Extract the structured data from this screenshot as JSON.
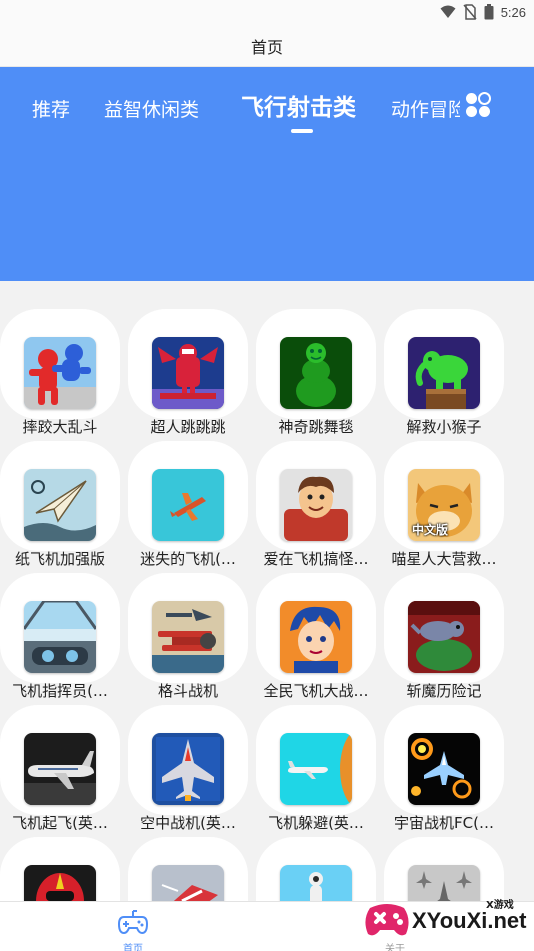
{
  "status_bar": {
    "time": "5:26",
    "icons": [
      "wifi-icon",
      "no-sim-icon",
      "battery-icon"
    ]
  },
  "app_bar": {
    "title": "首页"
  },
  "colors": {
    "accent": "#4f8ef7",
    "background": "#f2f2f2",
    "card": "#ffffff"
  },
  "tabs": [
    {
      "label": "推荐",
      "active": false
    },
    {
      "label": "益智休闲类",
      "active": false
    },
    {
      "label": "飞行射击类",
      "active": true
    },
    {
      "label": "动作冒险类",
      "active": false
    }
  ],
  "games": [
    {
      "name": "摔跤大乱斗",
      "icon": "wrestling-game-icon"
    },
    {
      "name": "超人跳跳跳",
      "icon": "superhero-game-icon"
    },
    {
      "name": "神奇跳舞毯",
      "icon": "dance-game-icon"
    },
    {
      "name": "解救小猴子",
      "icon": "elephant-game-icon"
    },
    {
      "name": "纸飞机加强版",
      "icon": "paper-plane-game-icon"
    },
    {
      "name": "迷失的飞机(…",
      "icon": "plane-game-icon"
    },
    {
      "name": "爱在飞机搞怪…",
      "icon": "cartoon-boy-game-icon"
    },
    {
      "name": "喵星人大营救…",
      "icon": "cat-game-icon",
      "badge": "中文版"
    },
    {
      "name": "飞机指挥员(…",
      "icon": "cockpit-game-icon"
    },
    {
      "name": "格斗战机",
      "icon": "biplane-game-icon"
    },
    {
      "name": "全民飞机大战…",
      "icon": "anime-pilot-game-icon"
    },
    {
      "name": "斩魔历险记",
      "icon": "monster-game-icon"
    },
    {
      "name": "飞机起飞(英…",
      "icon": "airliner-game-icon"
    },
    {
      "name": "空中战机(英…",
      "icon": "fighter-jet-game-icon"
    },
    {
      "name": "飞机躲避(英…",
      "icon": "dodge-plane-game-icon"
    },
    {
      "name": "宇宙战机FC(…",
      "icon": "space-fighter-game-icon"
    },
    {
      "name": "",
      "icon": "ranger-game-icon"
    },
    {
      "name": "",
      "icon": "jet-race-game-icon"
    },
    {
      "name": "",
      "icon": "rocket-game-icon"
    },
    {
      "name": "",
      "icon": "squadron-game-icon"
    }
  ],
  "bottom_nav": {
    "home_label": "首页",
    "about_label": "关于"
  },
  "watermark": {
    "small": "X游戏",
    "text": "XYouXi.net"
  }
}
